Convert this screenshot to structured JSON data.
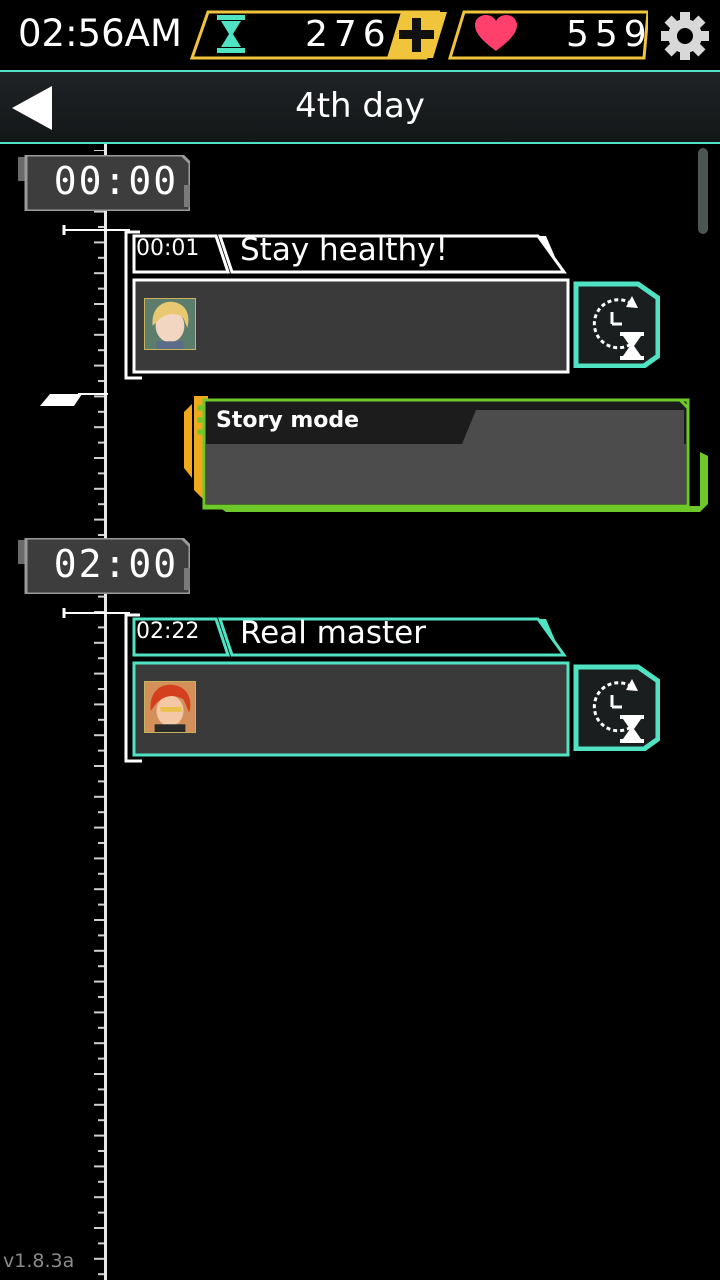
{
  "status_bar": {
    "clock": "02:56AM",
    "hourglass_count": "276",
    "hearts_count": "559",
    "icons": [
      "hourglass-icon",
      "plus-icon",
      "heart-icon",
      "gear-icon"
    ]
  },
  "header": {
    "title": "4th day",
    "back_icon": "back-arrow-icon"
  },
  "timeline": [
    {
      "slot": "00:00",
      "chats": [
        {
          "time": "00:01",
          "title": "Stay healthy!",
          "avatar": "blonde-character-avatar",
          "action_icon": "history-hourglass-icon"
        }
      ],
      "story": {
        "label": "Story mode"
      }
    },
    {
      "slot": "02:00",
      "chats": [
        {
          "time": "02:22",
          "title": "Real master",
          "avatar": "red-hair-character-avatar",
          "action_icon": "history-hourglass-icon"
        }
      ]
    }
  ],
  "version": "v1.8.3a",
  "colors": {
    "accent_cyan": "#4fe3c3",
    "accent_gold": "#f0c43b",
    "accent_green": "#6fc82a",
    "heart_pink": "#ff3f6c",
    "card_gray": "#3a3a3a"
  }
}
